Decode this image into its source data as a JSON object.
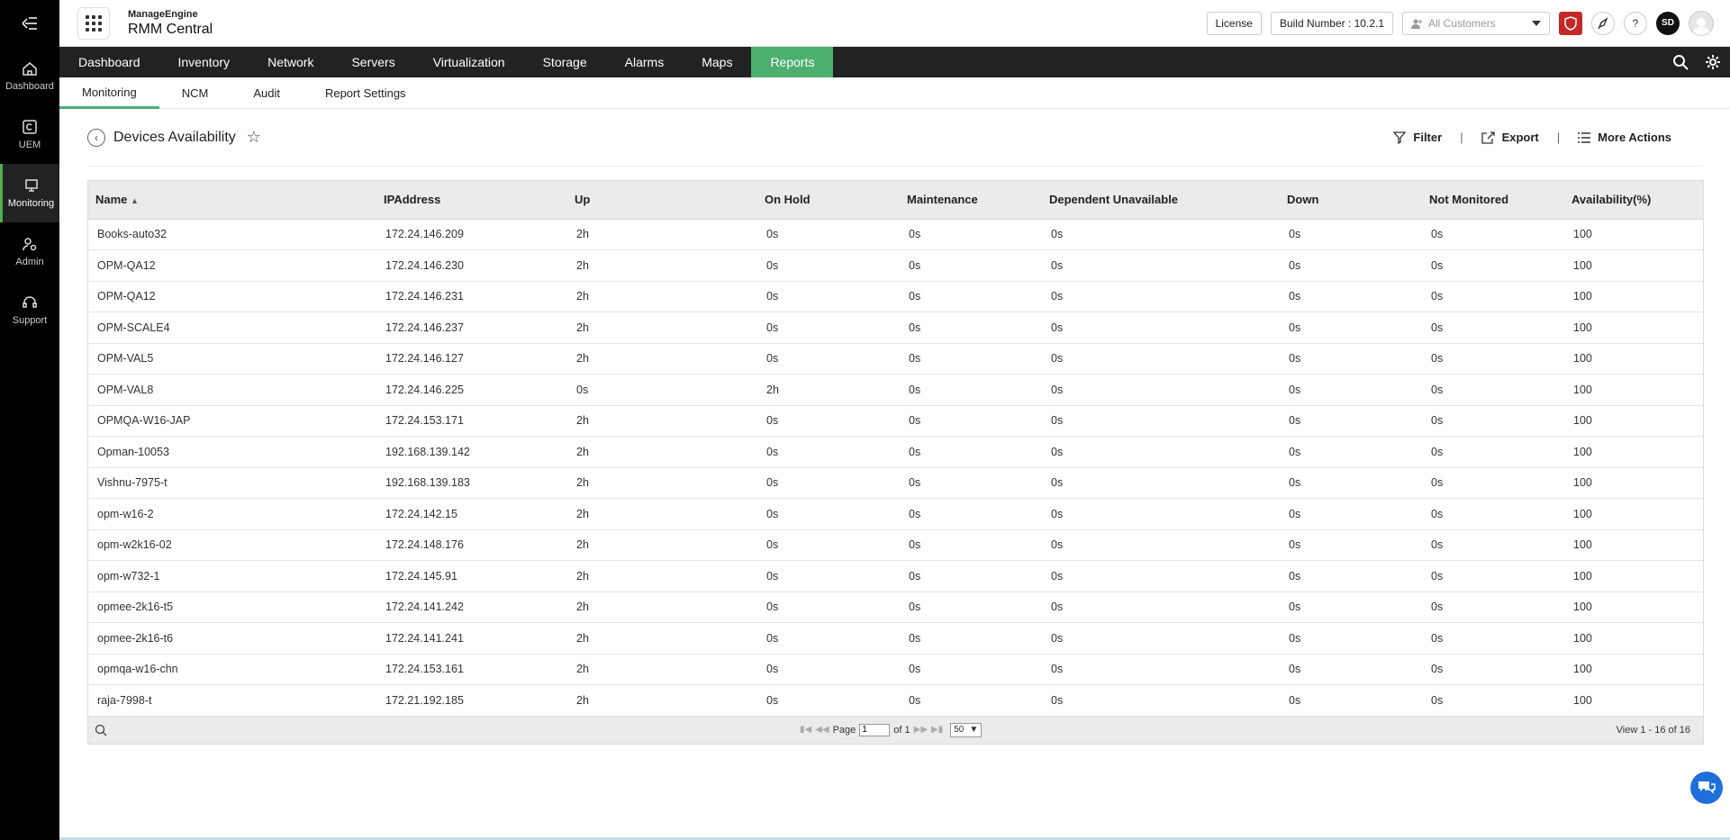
{
  "rail": {
    "items": [
      {
        "label": "Dashboard"
      },
      {
        "label": "UEM"
      },
      {
        "label": "Monitoring"
      },
      {
        "label": "Admin"
      },
      {
        "label": "Support"
      }
    ]
  },
  "header": {
    "brand_small": "ManageEngine",
    "brand_big": "RMM Central",
    "license": "License",
    "build": "Build Number : 10.2.1",
    "customers_placeholder": "All Customers",
    "user_initials": "SD"
  },
  "mainnav": [
    "Dashboard",
    "Inventory",
    "Network",
    "Servers",
    "Virtualization",
    "Storage",
    "Alarms",
    "Maps",
    "Reports"
  ],
  "subnav": [
    "Monitoring",
    "NCM",
    "Audit",
    "Report Settings"
  ],
  "page": {
    "title": "Devices Availability",
    "filter": "Filter",
    "export": "Export",
    "more": "More Actions",
    "sep": "|"
  },
  "table": {
    "columns": [
      "Name",
      "IPAddress",
      "Up",
      "On Hold",
      "Maintenance",
      "Dependent Unavailable",
      "Down",
      "Not Monitored",
      "Availability(%)"
    ],
    "rows": [
      [
        "Books-auto32",
        "172.24.146.209",
        "2h",
        "0s",
        "0s",
        "0s",
        "0s",
        "0s",
        "100"
      ],
      [
        "OPM-QA12",
        "172.24.146.230",
        "2h",
        "0s",
        "0s",
        "0s",
        "0s",
        "0s",
        "100"
      ],
      [
        "OPM-QA12",
        "172.24.146.231",
        "2h",
        "0s",
        "0s",
        "0s",
        "0s",
        "0s",
        "100"
      ],
      [
        "OPM-SCALE4",
        "172.24.146.237",
        "2h",
        "0s",
        "0s",
        "0s",
        "0s",
        "0s",
        "100"
      ],
      [
        "OPM-VAL5",
        "172.24.146.127",
        "2h",
        "0s",
        "0s",
        "0s",
        "0s",
        "0s",
        "100"
      ],
      [
        "OPM-VAL8",
        "172.24.146.225",
        "0s",
        "2h",
        "0s",
        "0s",
        "0s",
        "0s",
        "100"
      ],
      [
        "OPMQA-W16-JAP",
        "172.24.153.171",
        "2h",
        "0s",
        "0s",
        "0s",
        "0s",
        "0s",
        "100"
      ],
      [
        "Opman-10053",
        "192.168.139.142",
        "2h",
        "0s",
        "0s",
        "0s",
        "0s",
        "0s",
        "100"
      ],
      [
        "Vishnu-7975-t",
        "192.168.139.183",
        "2h",
        "0s",
        "0s",
        "0s",
        "0s",
        "0s",
        "100"
      ],
      [
        "opm-w16-2",
        "172.24.142.15",
        "2h",
        "0s",
        "0s",
        "0s",
        "0s",
        "0s",
        "100"
      ],
      [
        "opm-w2k16-02",
        "172.24.148.176",
        "2h",
        "0s",
        "0s",
        "0s",
        "0s",
        "0s",
        "100"
      ],
      [
        "opm-w732-1",
        "172.24.145.91",
        "2h",
        "0s",
        "0s",
        "0s",
        "0s",
        "0s",
        "100"
      ],
      [
        "opmee-2k16-t5",
        "172.24.141.242",
        "2h",
        "0s",
        "0s",
        "0s",
        "0s",
        "0s",
        "100"
      ],
      [
        "opmee-2k16-t6",
        "172.24.141.241",
        "2h",
        "0s",
        "0s",
        "0s",
        "0s",
        "0s",
        "100"
      ],
      [
        "opmqa-w16-chn",
        "172.24.153.161",
        "2h",
        "0s",
        "0s",
        "0s",
        "0s",
        "0s",
        "100"
      ],
      [
        "raja-7998-t",
        "172.21.192.185",
        "2h",
        "0s",
        "0s",
        "0s",
        "0s",
        "0s",
        "100"
      ]
    ]
  },
  "pager": {
    "page_label": "Page",
    "page_value": "1",
    "of_label": "of 1",
    "page_size": "50",
    "view": "View 1 - 16 of 16"
  }
}
